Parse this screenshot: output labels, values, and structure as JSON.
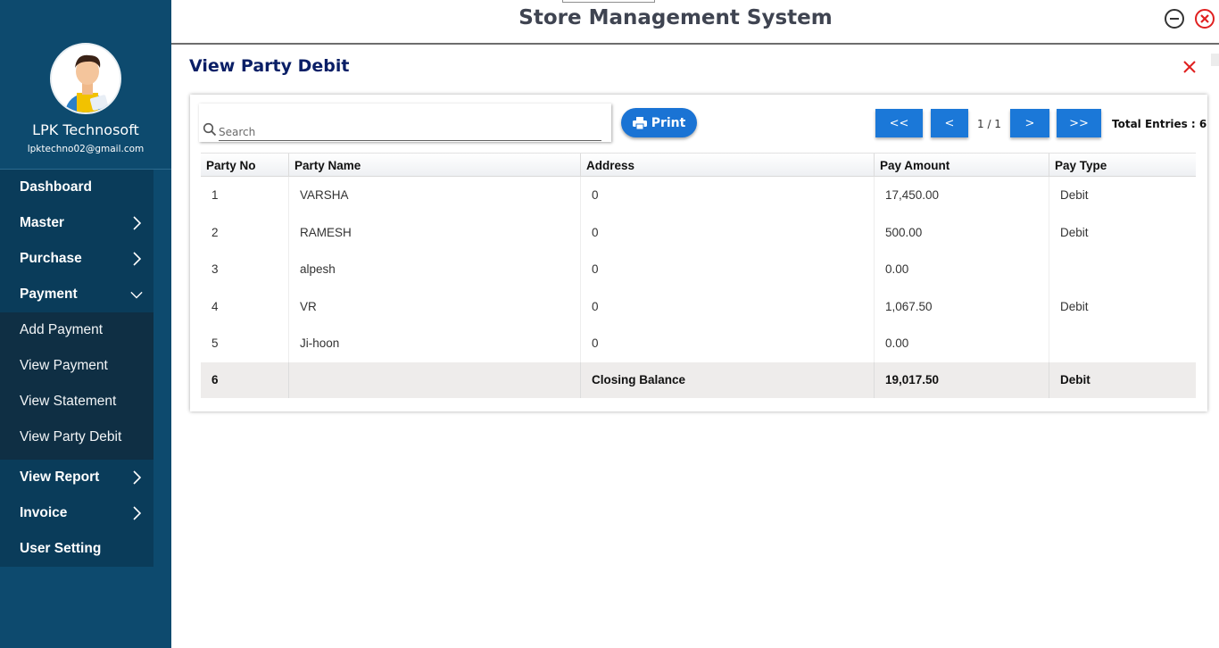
{
  "app": {
    "title": "Store Management System"
  },
  "profile": {
    "name": "LPK Technosoft",
    "email": "lpktechno02@gmail.com"
  },
  "menu": {
    "dashboard": "Dashboard",
    "master": "Master",
    "purchase": "Purchase",
    "payment": "Payment",
    "payment_sub": [
      "Add Payment",
      "View Payment",
      "View Statement",
      "View Party Debit"
    ],
    "view_report": "View Report",
    "invoice": "Invoice",
    "user_setting": "User Setting"
  },
  "page": {
    "title": "View Party Debit"
  },
  "toolbar": {
    "search_placeholder": "Search",
    "print_label": "Print",
    "first_label": "<<",
    "prev_label": "<",
    "page_info": "1 / 1",
    "next_label": ">",
    "last_label": ">>",
    "total_entries": "Total Entries : 6"
  },
  "table": {
    "headers": [
      "Party No",
      "Party Name",
      "Address",
      "Pay Amount",
      "Pay Type"
    ],
    "rows": [
      [
        "1",
        "VARSHA",
        "0",
        "17,450.00",
        "Debit"
      ],
      [
        "2",
        "RAMESH",
        "0",
        "500.00",
        "Debit"
      ],
      [
        "3",
        "alpesh",
        "0",
        "0.00",
        ""
      ],
      [
        "4",
        "VR",
        "0",
        "1,067.50",
        "Debit"
      ],
      [
        "5",
        "Ji-hoon",
        "0",
        "0.00",
        ""
      ]
    ],
    "footer": [
      "6",
      "",
      "Closing Balance",
      "19,017.50",
      "Debit"
    ]
  },
  "colors": {
    "sidebar": "#0d4a6e",
    "accent": "#1a73d4",
    "title": "#0a1f66",
    "close": "#e02020"
  },
  "icons": [
    "minimize-icon",
    "close-circle-icon",
    "close-icon",
    "search-icon",
    "printer-icon",
    "chevron-right-icon",
    "chevron-down-icon"
  ]
}
